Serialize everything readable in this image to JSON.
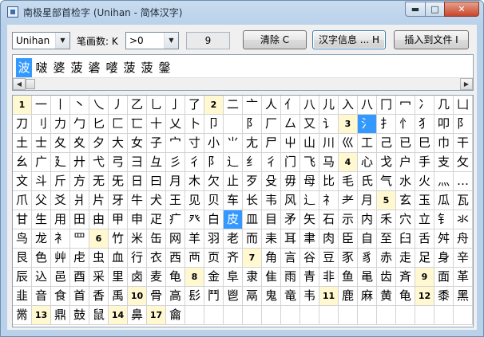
{
  "window": {
    "title": "南极星部首检字 (Unihan - 简体汉字)",
    "min_glyph": "▬",
    "max_glyph": "□",
    "close_glyph": "✕"
  },
  "toolbar": {
    "charset": "Unihan",
    "strokes_label": "笔画数: K",
    "strokes_value": ">0",
    "count": "9",
    "clear_label": "清除 C",
    "info_label": "汉字信息 ... H",
    "insert_label": "插入到文件 I",
    "dropdown_glyph": "▼"
  },
  "char_list": {
    "selected_index": 0,
    "chars": [
      "波",
      "啵",
      "婆",
      "菠",
      "碆",
      "嘙",
      "菠",
      "菠",
      "鎜"
    ]
  },
  "scroll": {
    "left": "◀",
    "right": "▶"
  },
  "grid": {
    "rows": [
      [
        "1",
        "一",
        "丨",
        "丶",
        "乀",
        "丿",
        "乙",
        "乚",
        "亅",
        "了",
        "2",
        "二",
        "亠",
        "人",
        "亻",
        "八",
        "儿",
        "入",
        "八",
        "冂",
        "冖",
        "冫",
        "几",
        "凵"
      ],
      [
        "刀",
        "刂",
        "力",
        "勹",
        "匕",
        "匚",
        "匸",
        "十",
        "乂",
        "卜",
        "卩",
        "",
        "阝",
        "厂",
        "厶",
        "又",
        "讠",
        "3",
        "氵",
        "扌",
        "忄",
        "犭",
        "叩",
        "阝"
      ],
      [
        "土",
        "士",
        "夂",
        "夊",
        "夕",
        "大",
        "女",
        "子",
        "宀",
        "寸",
        "小",
        "⺌",
        "尢",
        "尸",
        "屮",
        "山",
        "川",
        "巛",
        "工",
        "己",
        "已",
        "巳",
        "巾",
        "干"
      ],
      [
        "幺",
        "广",
        "廴",
        "廾",
        "弋",
        "弓",
        "彐",
        "彑",
        "彡",
        "彳",
        "阝",
        "辶",
        "纟",
        "彳",
        "门",
        "飞",
        "马",
        "4",
        "心",
        "戈",
        "户",
        "手",
        "支",
        "攵"
      ],
      [
        "文",
        "斗",
        "斤",
        "方",
        "无",
        "旡",
        "日",
        "曰",
        "月",
        "木",
        "欠",
        "止",
        "歹",
        "殳",
        "毋",
        "母",
        "比",
        "毛",
        "氏",
        "气",
        "水",
        "火",
        "灬",
        "…"
      ],
      [
        "爪",
        "父",
        "爻",
        "爿",
        "片",
        "牙",
        "牛",
        "犬",
        "王",
        "见",
        "贝",
        "车",
        "长",
        "韦",
        "风",
        "辶",
        "礻",
        "耂",
        "月",
        "5",
        "玄",
        "玉",
        "瓜",
        "瓦"
      ],
      [
        "甘",
        "生",
        "用",
        "田",
        "由",
        "甲",
        "申",
        "疋",
        "疒",
        "癶",
        "白",
        "皮",
        "皿",
        "目",
        "矛",
        "矢",
        "石",
        "示",
        "内",
        "禾",
        "穴",
        "立",
        "钅",
        "氺"
      ],
      [
        "鸟",
        "龙",
        "衤",
        "罒",
        "6",
        "竹",
        "米",
        "缶",
        "网",
        "羊",
        "羽",
        "老",
        "而",
        "耒",
        "耳",
        "聿",
        "肉",
        "臣",
        "自",
        "至",
        "臼",
        "舌",
        "舛",
        "舟"
      ],
      [
        "艮",
        "色",
        "艸",
        "虍",
        "虫",
        "血",
        "行",
        "衣",
        "西",
        "襾",
        "页",
        "齐",
        "7",
        "角",
        "言",
        "谷",
        "豆",
        "豕",
        "豸",
        "赤",
        "走",
        "足",
        "身",
        "辛"
      ],
      [
        "辰",
        "込",
        "邑",
        "酉",
        "采",
        "里",
        "卤",
        "麦",
        "龟",
        "8",
        "金",
        "阜",
        "隶",
        "隹",
        "雨",
        "青",
        "非",
        "鱼",
        "黾",
        "齿",
        "斉",
        "9",
        "面",
        "革"
      ],
      [
        "韭",
        "音",
        "食",
        "首",
        "香",
        "禹",
        "10",
        "骨",
        "高",
        "髟",
        "鬥",
        "鬯",
        "鬲",
        "鬼",
        "竜",
        "韦",
        "11",
        "鹿",
        "麻",
        "黄",
        "龟",
        "12",
        "黍",
        "黑"
      ],
      [
        "黹",
        "13",
        "鼎",
        "鼓",
        "鼠",
        "14",
        "鼻",
        "17",
        "龠",
        "",
        "",
        "",
        "",
        "",
        "",
        "",
        "",
        "",
        "",
        "",
        "",
        "",
        "",
        ""
      ]
    ],
    "selected": [
      {
        "row": 1,
        "col": 18
      },
      {
        "row": 6,
        "col": 11
      }
    ]
  }
}
